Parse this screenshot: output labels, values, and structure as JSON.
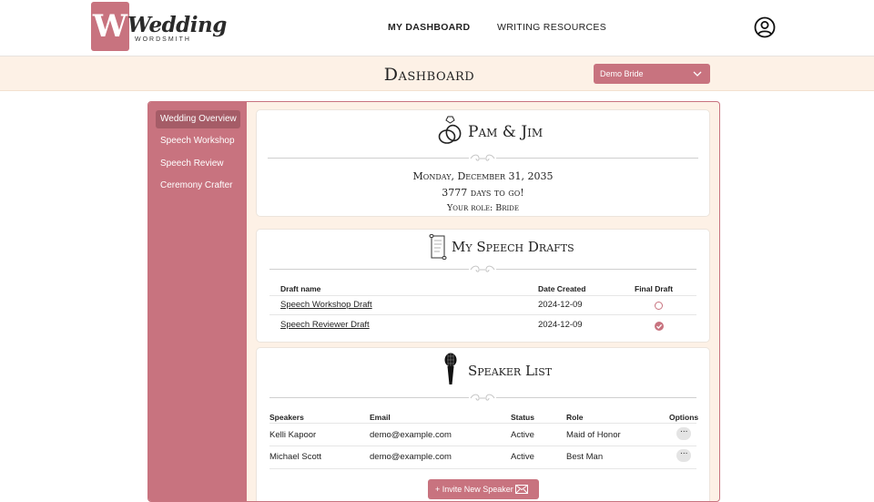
{
  "logo": {
    "badge": "W",
    "word": "Wedding",
    "sub": "WORDSMITH"
  },
  "nav": {
    "dashboard": "MY DASHBOARD",
    "resources": "WRITING RESOURCES"
  },
  "dashboard": {
    "title": "Dashboard",
    "role_select": "Demo Bride"
  },
  "sidebar": {
    "items": [
      {
        "label": "Wedding Overview"
      },
      {
        "label": "Speech Workshop"
      },
      {
        "label": "Speech Review"
      },
      {
        "label": "Ceremony Crafter"
      }
    ]
  },
  "overview": {
    "couple": "Pam & Jim",
    "date": "Monday, December 31, 2035",
    "countdown": "3777 days to go!",
    "role": "Your role: Bride"
  },
  "drafts": {
    "title": "My Speech Drafts",
    "headers": {
      "name": "Draft name",
      "date": "Date Created",
      "final": "Final Draft"
    },
    "rows": [
      {
        "name": "Speech Workshop Draft",
        "date": "2024-12-09",
        "final": false
      },
      {
        "name": "Speech Reviewer Draft",
        "date": "2024-12-09",
        "final": true
      }
    ]
  },
  "speakers": {
    "title": "Speaker List",
    "headers": {
      "name": "Speakers",
      "email": "Email",
      "status": "Status",
      "role": "Role",
      "options": "Options"
    },
    "rows": [
      {
        "name": "Kelli Kapoor",
        "email": "demo@example.com",
        "status": "Active",
        "role": "Maid of Honor"
      },
      {
        "name": "Michael Scott",
        "email": "demo@example.com",
        "status": "Active",
        "role": "Best Man"
      }
    ],
    "invite_label": "+ Invite New Speaker"
  },
  "colors": {
    "accent": "#c8737f",
    "accent_dark": "#a55c67",
    "cream": "#fdf1e6"
  },
  "icons": [
    "user-icon",
    "chevron-down-icon",
    "rings-icon",
    "scroll-icon",
    "microphone-icon",
    "flourish-icon",
    "envelope-icon",
    "more-options-icon"
  ]
}
